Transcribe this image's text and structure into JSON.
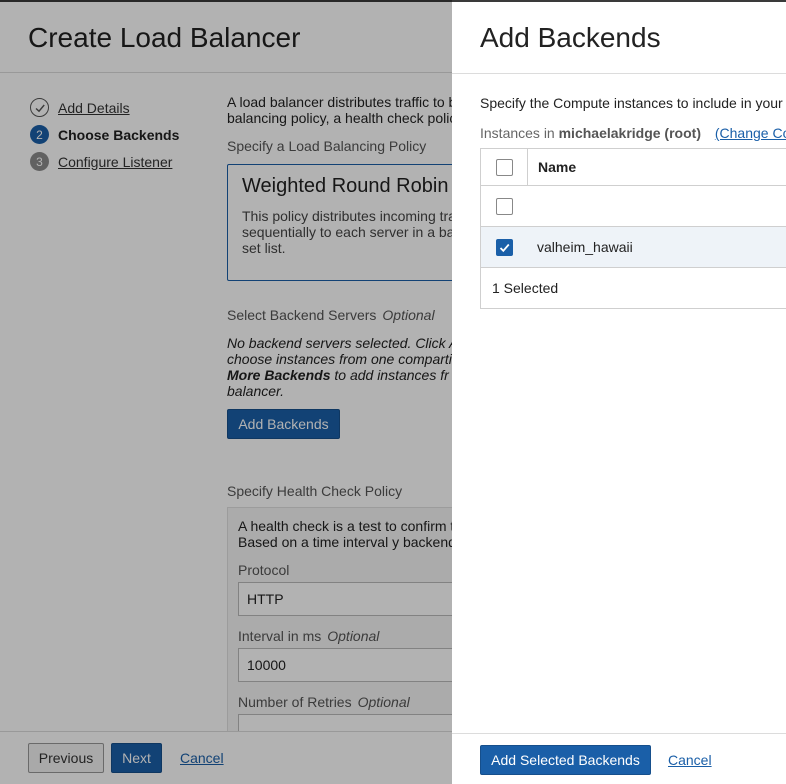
{
  "wizard": {
    "title": "Create Load Balancer",
    "steps": [
      {
        "number": "✓",
        "label": "Add Details",
        "state": "done"
      },
      {
        "number": "2",
        "label": "Choose Backends",
        "state": "current"
      },
      {
        "number": "3",
        "label": "Configure Listener",
        "state": "todo"
      }
    ],
    "intro_line1": "A load balancer distributes traffic to b",
    "intro_line2": "balancing policy, a health check polic",
    "policy_section_label": "Specify a Load Balancing Policy",
    "policy_card": {
      "title": "Weighted Round Robin",
      "description": "This policy distributes incoming traffic sequentially to each server in a backend set list."
    },
    "backend_servers_label": "Select Backend Servers",
    "optional_label": "Optional",
    "no_backends_line1": "No backend servers selected. Click A",
    "no_backends_line2": "choose instances from one comparti",
    "no_backends_bold": "More Backends",
    "no_backends_line3_rest": " to add instances fr",
    "no_backends_line4": "balancer.",
    "add_backends_button": "Add Backends",
    "health_check_label": "Specify Health Check Policy",
    "health_check_text": "A health check is a test to confirm t attempt. Based on a time interval y backend servers.",
    "protocol_label": "Protocol",
    "protocol_value": "HTTP",
    "interval_label": "Interval in ms",
    "interval_value": "10000",
    "retries_label": "Number of Retries",
    "footer": {
      "previous": "Previous",
      "next": "Next",
      "cancel": "Cancel"
    }
  },
  "panel": {
    "title": "Add Backends",
    "description": "Specify the Compute instances to include in your",
    "compartment_prefix": "Instances in",
    "compartment_name": "michaelakridge (root)",
    "change_compartment": "(Change Co",
    "table": {
      "column_name": "Name",
      "rows": [
        {
          "name": "",
          "checked": false
        },
        {
          "name": "valheim_hawaii",
          "checked": true
        }
      ],
      "selected_count": "1 Selected"
    },
    "footer": {
      "add_selected": "Add Selected Backends",
      "cancel": "Cancel"
    }
  },
  "colors": {
    "accent": "#1a5fa8",
    "overlay": "rgba(0,0,0,0.30)"
  }
}
